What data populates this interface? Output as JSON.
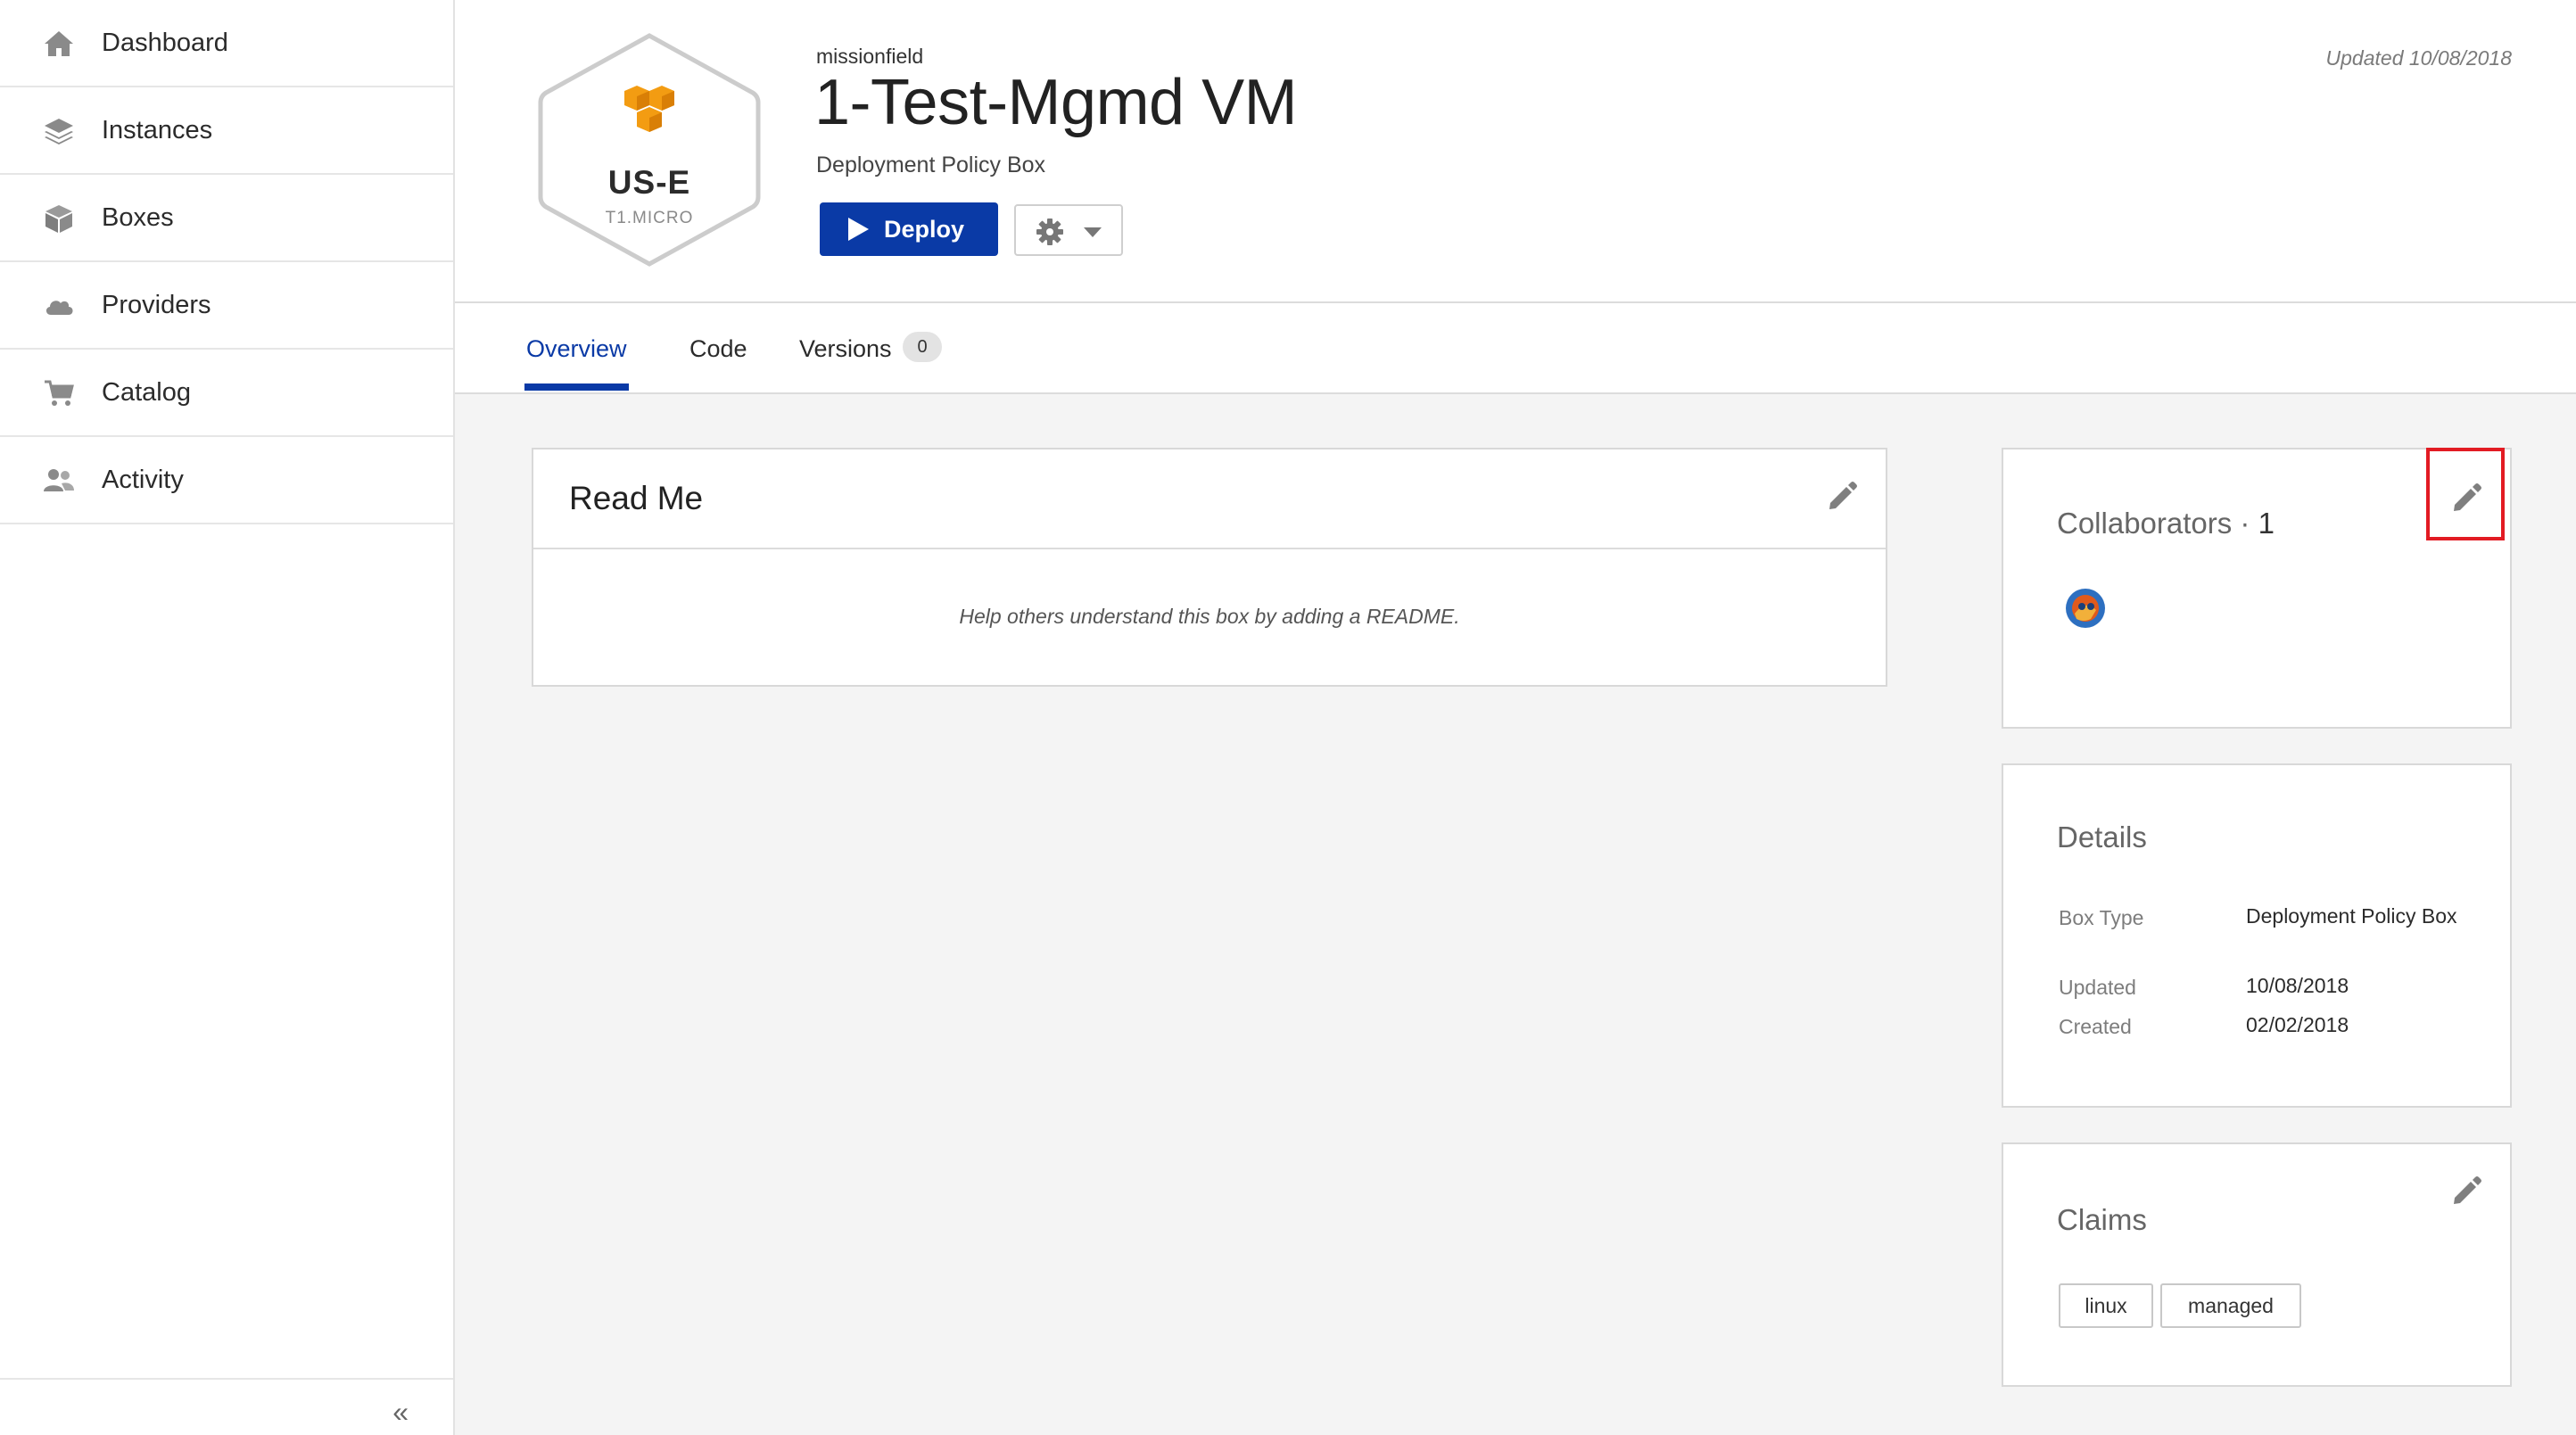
{
  "sidebar": {
    "items": [
      {
        "label": "Dashboard",
        "icon": "home-icon"
      },
      {
        "label": "Instances",
        "icon": "layers-icon"
      },
      {
        "label": "Boxes",
        "icon": "box-icon"
      },
      {
        "label": "Providers",
        "icon": "cloud-icon"
      },
      {
        "label": "Catalog",
        "icon": "cart-icon"
      },
      {
        "label": "Activity",
        "icon": "users-icon"
      }
    ],
    "collapse_label": "«"
  },
  "box": {
    "region": "US-E",
    "instance_size": "T1.MICRO",
    "provider_icon": "aws-cubes-icon",
    "owner": "missionfield",
    "title": "1-Test-Mgmd VM",
    "type": "Deployment Policy Box",
    "updated_label": "Updated 10/08/2018"
  },
  "actions": {
    "deploy_label": "Deploy"
  },
  "tabs": [
    {
      "label": "Overview",
      "active": true
    },
    {
      "label": "Code",
      "active": false
    },
    {
      "label": "Versions",
      "active": false,
      "badge": "0"
    }
  ],
  "readme": {
    "title": "Read Me",
    "empty_text": "Help others understand this box by adding a README."
  },
  "collaborators": {
    "title": "Collaborators · ",
    "count": "1"
  },
  "details": {
    "title": "Details",
    "rows": [
      {
        "label": "Box Type",
        "value": "Deployment Policy Box"
      },
      {
        "label": "Updated",
        "value": "10/08/2018"
      },
      {
        "label": "Created",
        "value": "02/02/2018"
      }
    ]
  },
  "claims": {
    "title": "Claims",
    "tags": [
      "linux",
      "managed"
    ]
  },
  "colors": {
    "primary": "#0a3aa6",
    "aws_orange": "#f39c12",
    "highlight": "#e21b23"
  }
}
